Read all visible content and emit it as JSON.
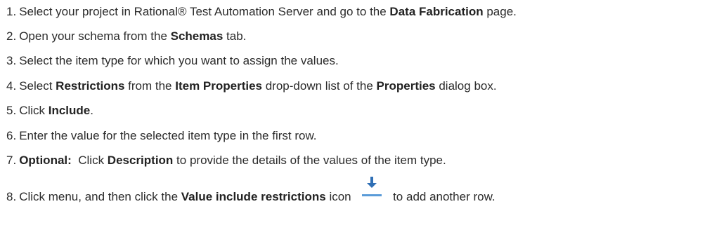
{
  "steps": [
    {
      "number": "1.",
      "parts": [
        {
          "t": "Select your project in Rational® Test Automation Server and go to the "
        },
        {
          "b": "Data Fabrication"
        },
        {
          "t": " page."
        }
      ]
    },
    {
      "number": "2.",
      "parts": [
        {
          "t": "Open your schema from the "
        },
        {
          "b": "Schemas"
        },
        {
          "t": " tab."
        }
      ]
    },
    {
      "number": "3.",
      "parts": [
        {
          "t": "Select the item type for which you want to assign the values."
        }
      ]
    },
    {
      "number": "4.",
      "parts": [
        {
          "t": "Select "
        },
        {
          "b": "Restrictions"
        },
        {
          "t": " from the "
        },
        {
          "b": "Item Properties"
        },
        {
          "t": " drop-down list of the "
        },
        {
          "b": "Properties"
        },
        {
          "t": " dialog box."
        }
      ]
    },
    {
      "number": "5.",
      "parts": [
        {
          "t": "Click "
        },
        {
          "b": "Include"
        },
        {
          "t": "."
        }
      ]
    },
    {
      "number": "6.",
      "parts": [
        {
          "t": "Enter the value for the selected item type in the first row."
        }
      ]
    },
    {
      "number": "7.",
      "parts": [
        {
          "b": "Optional:"
        },
        {
          "t": "  Click "
        },
        {
          "b": "Description"
        },
        {
          "t": " to provide the details of the values of the item type."
        }
      ]
    },
    {
      "number": "8.",
      "parts": [
        {
          "t": "Click menu, and then click the "
        },
        {
          "b": "Value include restrictions"
        },
        {
          "t": " icon "
        },
        {
          "icon": "download-icon"
        },
        {
          "t": " to add another row."
        }
      ]
    }
  ],
  "colors": {
    "text": "#2b2b2b",
    "icon_arrow": "#2f6fb5",
    "icon_base": "#5a9bd8"
  }
}
